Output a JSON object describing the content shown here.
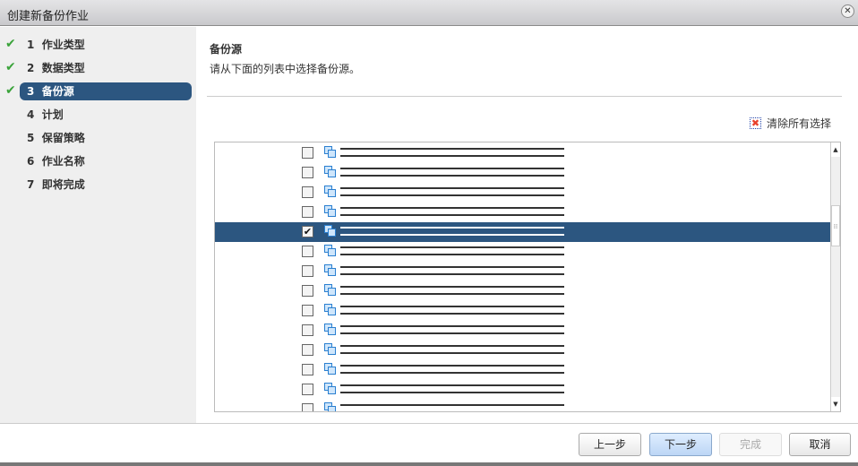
{
  "window": {
    "title": "创建新备份作业",
    "close_icon": "close-icon"
  },
  "steps": [
    {
      "num": "1",
      "label": "作业类型",
      "done": true
    },
    {
      "num": "2",
      "label": "数据类型",
      "done": true
    },
    {
      "num": "3",
      "label": "备份源",
      "done": true,
      "current": true
    },
    {
      "num": "4",
      "label": "计划"
    },
    {
      "num": "5",
      "label": "保留策略"
    },
    {
      "num": "6",
      "label": "作业名称"
    },
    {
      "num": "7",
      "label": "即将完成"
    }
  ],
  "main": {
    "heading": "备份源",
    "instruction": "请从下面的列表中选择备份源。",
    "clear_label": "清除所有选择",
    "clear_icon": "red-x-icon"
  },
  "list": {
    "item_icon": "vm-icon",
    "items": [
      {
        "checked": false
      },
      {
        "checked": false
      },
      {
        "checked": false
      },
      {
        "checked": false
      },
      {
        "checked": true,
        "selected": true
      },
      {
        "checked": false
      },
      {
        "checked": false
      },
      {
        "checked": false
      },
      {
        "checked": false
      },
      {
        "checked": false
      },
      {
        "checked": false
      },
      {
        "checked": false
      },
      {
        "checked": false
      },
      {
        "checked": false
      }
    ]
  },
  "footer": {
    "prev": "上一步",
    "next": "下一步",
    "finish": "完成",
    "cancel": "取消"
  },
  "colors": {
    "accent": "#2c5680",
    "check": "#3aa33a"
  }
}
